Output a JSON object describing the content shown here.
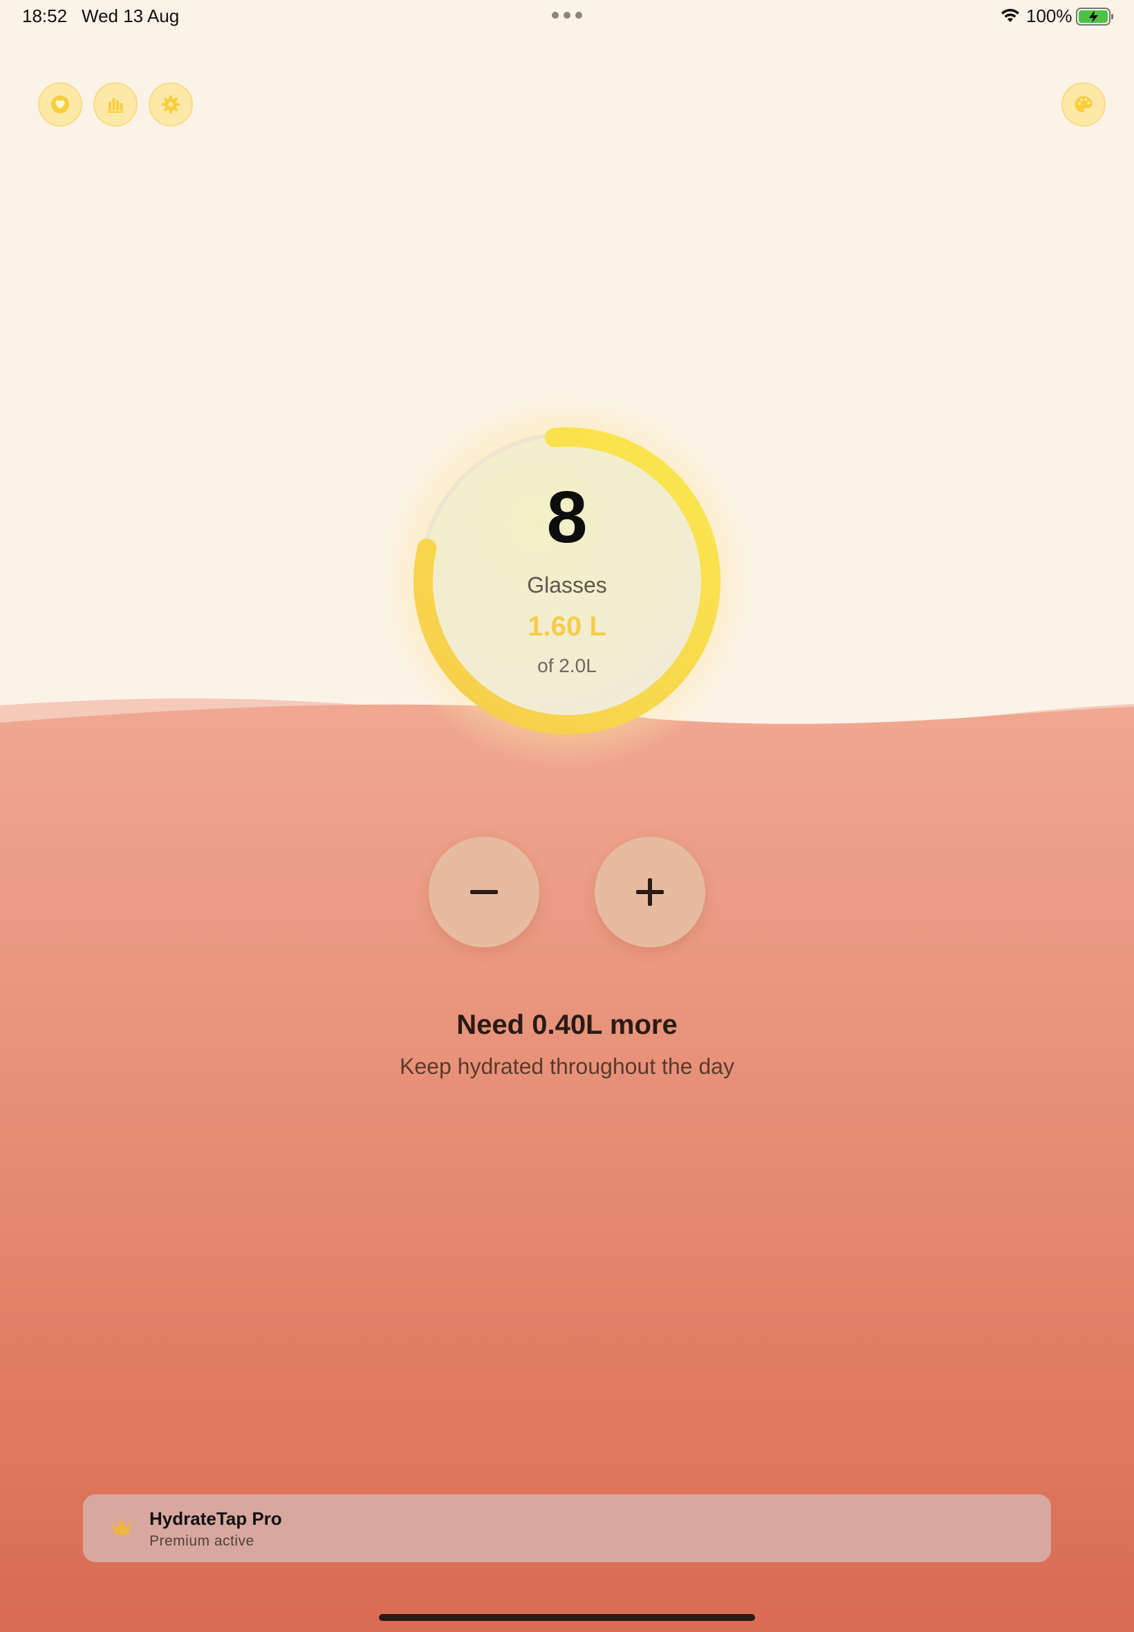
{
  "status_bar": {
    "time": "18:52",
    "date": "Wed 13 Aug",
    "battery_percent": "100%",
    "icons": [
      "wifi-icon",
      "battery-charging-icon"
    ]
  },
  "toolbar": {
    "buttons": [
      {
        "icon": "heart-icon"
      },
      {
        "icon": "stats-bars-icon"
      },
      {
        "icon": "gear-icon"
      },
      {
        "icon": "palette-icon"
      }
    ]
  },
  "progress": {
    "glasses_count": "8",
    "unit_label": "Glasses",
    "liters_text": "1.60 L",
    "goal_text": "of 2.0L",
    "fraction": 0.8
  },
  "controls": {
    "minus_icon": "minus-icon",
    "plus_icon": "plus-icon"
  },
  "message": {
    "need": "Need 0.40L more",
    "hint": "Keep hydrated throughout the day"
  },
  "pro_banner": {
    "icon": "crown-icon",
    "title": "HydrateTap Pro",
    "subtitle": "Premium active"
  },
  "colors": {
    "background": "#fcf3e8",
    "accent_yellow": "#f9d74a",
    "water_top": "#f0a890",
    "water_bottom": "#d96d55"
  }
}
